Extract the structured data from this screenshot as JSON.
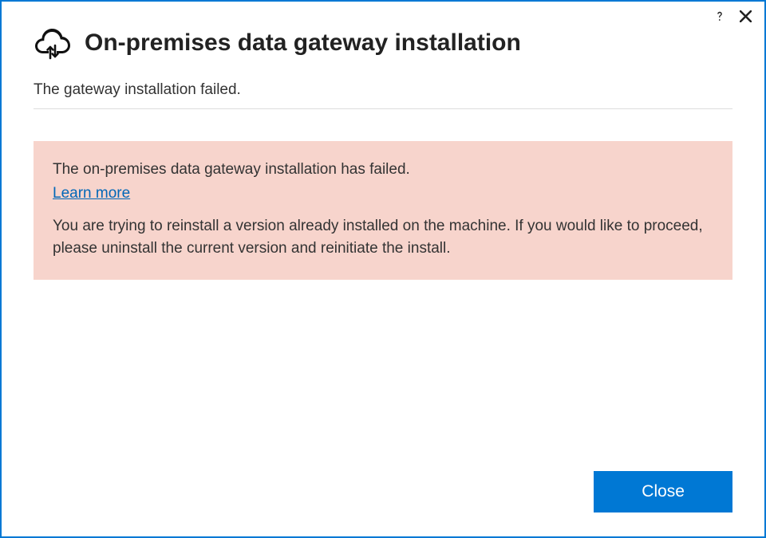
{
  "window": {
    "title": "On-premises data gateway installation"
  },
  "status": {
    "message": "The gateway installation failed."
  },
  "error": {
    "heading": "The on-premises data gateway installation has failed.",
    "learn_more_label": "Learn more",
    "detail": "You are trying to reinstall a version already installed on the machine. If you would like to proceed, please uninstall the current version and reinitiate the install."
  },
  "footer": {
    "close_label": "Close"
  }
}
